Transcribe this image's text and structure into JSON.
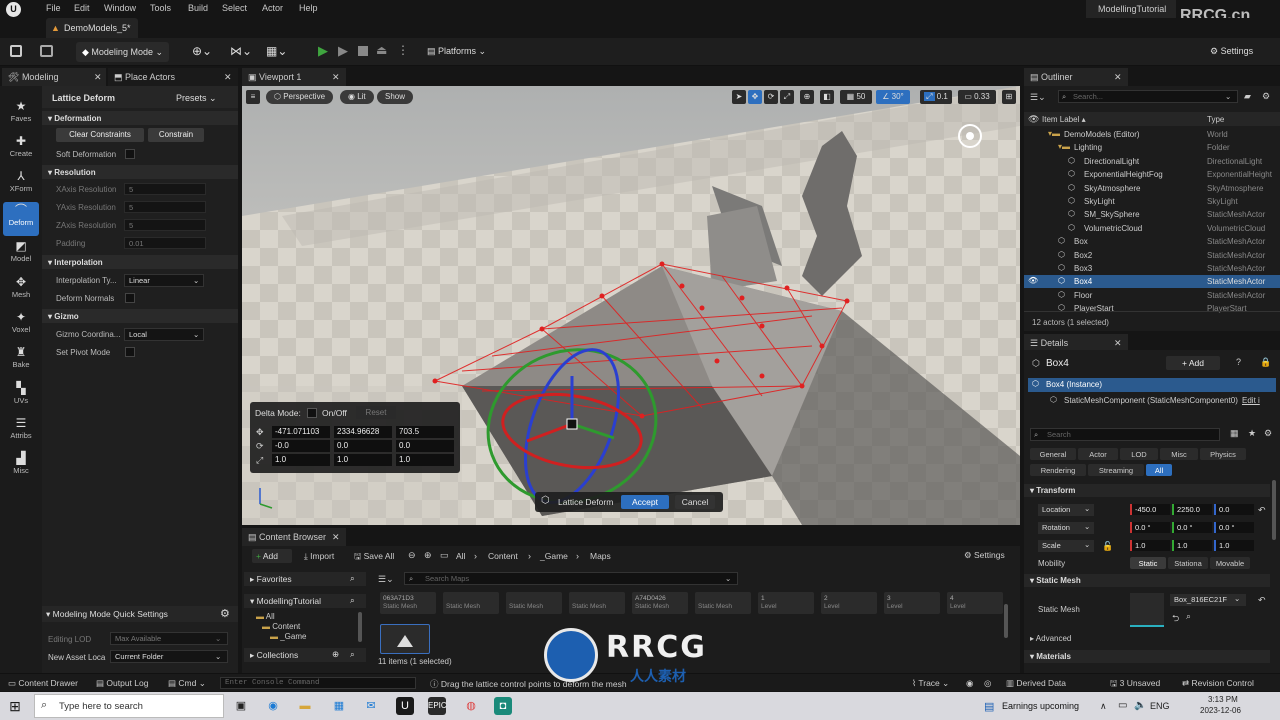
{
  "menubar": {
    "items": [
      "File",
      "Edit",
      "Window",
      "Tools",
      "Build",
      "Select",
      "Actor",
      "Help"
    ],
    "project_name": "ModellingTutorial",
    "watermark_top": "RRCG.cn"
  },
  "doc_tab": {
    "label": "DemoModels_5*"
  },
  "toolbar": {
    "mode_label": "Modeling Mode",
    "platforms_label": "Platforms",
    "settings_label": "Settings"
  },
  "left_panel": {
    "tabs": [
      "Modeling",
      "Place Actors"
    ],
    "tools": [
      "Faves",
      "Create",
      "XForm",
      "Deform",
      "Model",
      "Mesh",
      "Voxel",
      "Bake",
      "UVs",
      "Attribs",
      "Misc"
    ],
    "tool_title": "Lattice Deform",
    "presets_label": "Presets",
    "sections": {
      "deformation": "Deformation",
      "resolution": "Resolution",
      "interpolation": "Interpolation",
      "gizmo": "Gizmo"
    },
    "clear_constraints": "Clear Constraints",
    "constrain": "Constrain",
    "soft_deformation": "Soft Deformation",
    "x_axis_resolution": "XAxis Resolution",
    "x_axis_value": "5",
    "y_axis_resolution": "YAxis Resolution",
    "y_axis_value": "5",
    "z_axis_resolution": "ZAxis Resolution",
    "z_axis_value": "5",
    "padding": "Padding",
    "padding_value": "0.01",
    "interpolation_type": "Interpolation Ty...",
    "interpolation_value": "Linear",
    "deform_normals": "Deform Normals",
    "gizmo_coordinates": "Gizmo Coordina...",
    "gizmo_coordinates_value": "Local",
    "set_pivot_mode": "Set Pivot Mode",
    "quick_settings_title": "Modeling Mode Quick Settings",
    "editing_lod": "Editing LOD",
    "editing_lod_value": "Max Available",
    "new_asset_location": "New Asset Loca",
    "new_asset_location_value": "Current Folder"
  },
  "viewport": {
    "tab": "Viewport 1",
    "perspective": "Perspective",
    "lit": "Lit",
    "show": "Show",
    "grid_snap": "50",
    "rotation_snap": "30°",
    "scale_snap": "0.1",
    "camera_speed": "0.33",
    "delta_mode_label": "Delta Mode:",
    "on_off": "On/Off",
    "reset": "Reset",
    "location": [
      "-471.071103",
      "2334.96628",
      "703.5"
    ],
    "rotation": [
      "-0.0",
      "0.0",
      "0.0"
    ],
    "scale": [
      "1.0",
      "1.0",
      "1.0"
    ],
    "lattice_label": "Lattice Deform",
    "accept": "Accept",
    "cancel": "Cancel"
  },
  "outliner": {
    "title": "Outliner",
    "search_placeholder": "Search...",
    "col_label": "Item Label",
    "col_type": "Type",
    "rows": [
      {
        "label": "DemoModels (Editor)",
        "type": "World",
        "indent": 1
      },
      {
        "label": "Lighting",
        "type": "Folder",
        "indent": 2
      },
      {
        "label": "DirectionalLight",
        "type": "DirectionalLight",
        "indent": 3
      },
      {
        "label": "ExponentialHeightFog",
        "type": "ExponentialHeight",
        "indent": 3
      },
      {
        "label": "SkyAtmosphere",
        "type": "SkyAtmosphere",
        "indent": 3
      },
      {
        "label": "SkyLight",
        "type": "SkyLight",
        "indent": 3
      },
      {
        "label": "SM_SkySphere",
        "type": "StaticMeshActor",
        "indent": 3
      },
      {
        "label": "VolumetricCloud",
        "type": "VolumetricCloud",
        "indent": 3
      },
      {
        "label": "Box",
        "type": "StaticMeshActor",
        "indent": 2
      },
      {
        "label": "Box2",
        "type": "StaticMeshActor",
        "indent": 2
      },
      {
        "label": "Box3",
        "type": "StaticMeshActor",
        "indent": 2
      },
      {
        "label": "Box4",
        "type": "StaticMeshActor",
        "indent": 2,
        "selected": true
      },
      {
        "label": "Floor",
        "type": "StaticMeshActor",
        "indent": 2
      },
      {
        "label": "PlayerStart",
        "type": "PlayerStart",
        "indent": 2
      }
    ],
    "footer": "12 actors (1 selected)"
  },
  "details": {
    "title": "Details",
    "actor_name": "Box4",
    "add_label": "+ Add",
    "instance_label": "Box4 (Instance)",
    "component_label": "StaticMeshComponent (StaticMeshComponent0)",
    "edit_label": "Edit i",
    "search_placeholder": "Search",
    "tabs_row1": [
      "General",
      "Actor",
      "LOD",
      "Misc",
      "Physics"
    ],
    "tabs_row2": [
      "Rendering",
      "Streaming",
      "All"
    ],
    "transform_section": "Transform",
    "location_label": "Location",
    "location": [
      "-450.0",
      "2250.0",
      "0.0"
    ],
    "rotation_label": "Rotation",
    "rotation": [
      "0.0 °",
      "0.0 °",
      "0.0 °"
    ],
    "scale_label": "Scale",
    "scale": [
      "1.0",
      "1.0",
      "1.0"
    ],
    "mobility_label": "Mobility",
    "mobility_options": [
      "Static",
      "Stationa",
      "Movable"
    ],
    "static_mesh_section": "Static Mesh",
    "static_mesh_label": "Static Mesh",
    "static_mesh_value": "Box_816EC21F",
    "advanced": "Advanced",
    "materials": "Materials"
  },
  "content_browser": {
    "title": "Content Browser",
    "add": "Add",
    "import": "Import",
    "save_all": "Save All",
    "breadcrumb": [
      "All",
      "Content",
      "_Game",
      "Maps"
    ],
    "settings": "Settings",
    "favorites": "Favorites",
    "project": "ModellingTutorial",
    "tree": [
      "All",
      "Content",
      "_Game"
    ],
    "collections": "Collections",
    "search_placeholder": "Search Maps",
    "assets": [
      {
        "name": "063A71D3",
        "type": "Static Mesh"
      },
      {
        "name": "",
        "type": "Static Mesh"
      },
      {
        "name": "",
        "type": "Static Mesh"
      },
      {
        "name": "",
        "type": "Static Mesh"
      },
      {
        "name": "A74D0426",
        "type": "Static Mesh"
      },
      {
        "name": "",
        "type": "Static Mesh"
      },
      {
        "name": "1",
        "type": "Level"
      },
      {
        "name": "2",
        "type": "Level"
      },
      {
        "name": "3",
        "type": "Level"
      },
      {
        "name": "4",
        "type": "Level"
      }
    ],
    "count": "11 items (1 selected)"
  },
  "statusbar": {
    "content_drawer": "Content Drawer",
    "output_log": "Output Log",
    "cmd": "Cmd",
    "console_placeholder": "Enter Console Command",
    "hint": "Drag the lattice control points to deform the mesh",
    "trace": "Trace",
    "derived_data": "Derived Data",
    "unsaved": "3 Unsaved",
    "revision_control": "Revision Control"
  },
  "taskbar": {
    "search_placeholder": "Type here to search",
    "earnings": "Earnings upcoming",
    "lang": "ENG",
    "time": "3:13 PM",
    "date": "2023-12-06"
  },
  "watermark": {
    "big": "RRCG",
    "sub": "人人素材"
  }
}
